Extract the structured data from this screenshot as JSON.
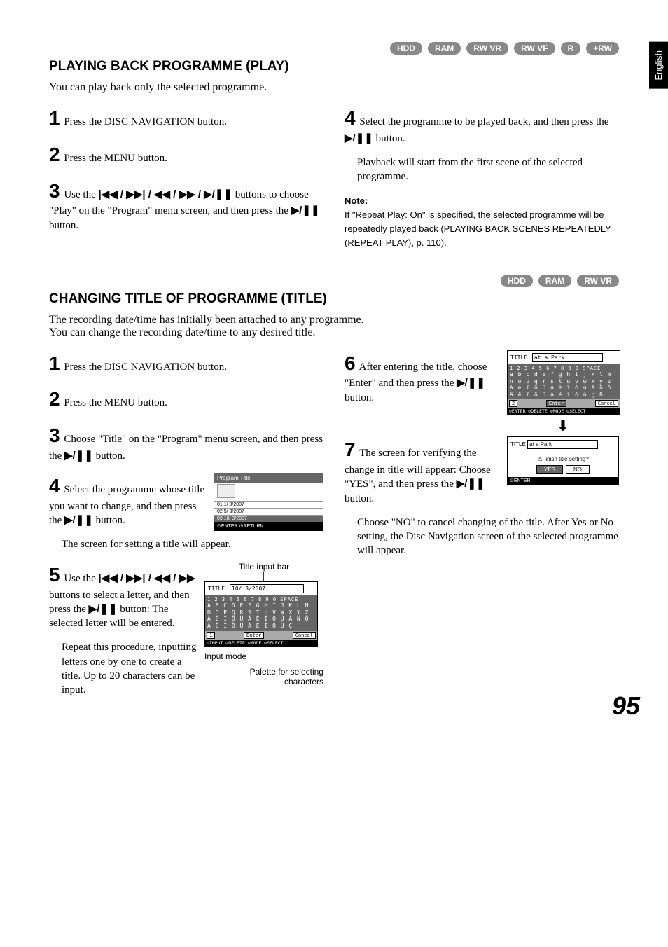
{
  "side_tab": "English",
  "section1": {
    "badges": [
      "HDD",
      "RAM",
      "RW VR",
      "RW VF",
      "R",
      "+RW"
    ],
    "title": "PLAYING BACK PROGRAMME (PLAY)",
    "intro": "You can play back only the selected programme.",
    "steps_left": {
      "s1": "Press the DISC NAVIGATION button.",
      "s2": "Press the MENU button.",
      "s3a": "Use the ",
      "s3b": " buttons to choose \"Play\" on the \"Program\" menu screen, and then press the ",
      "s3c": " button."
    },
    "steps_right": {
      "s4a": "Select the programme to be played back, and then press the ",
      "s4b": " button.",
      "s4c": "Playback will start from the first scene of the selected programme."
    },
    "note_head": "Note:",
    "note_body": "If \"Repeat Play: On\" is specified, the selected programme will be repeatedly played back (PLAYING BACK SCENES REPEATEDLY (REPEAT PLAY), p. 110)."
  },
  "section2": {
    "badges": [
      "HDD",
      "RAM",
      "RW VR"
    ],
    "title": "CHANGING TITLE OF PROGRAMME (TITLE)",
    "intro": "The recording date/time has initially been attached to any programme.\nYou can change the recording date/time to any desired title.",
    "left": {
      "s1": "Press the DISC NAVIGATION button.",
      "s2": "Press the MENU button.",
      "s3a": "Choose \"Title\" on the \"Program\" menu screen, and then press the ",
      "s3b": " button.",
      "s4a": "Select the programme whose title you want to change, and then press the ",
      "s4b": " button.",
      "s4c": "The screen for setting a title will appear.",
      "s5a": "Use the ",
      "s5b": " buttons to select a letter, and then press the ",
      "s5c": " button: The selected letter will be entered.",
      "s5d": "Repeat this procedure, inputting letters one by one to create a title. Up to 20 characters can be input."
    },
    "right": {
      "s6a": "After entering the title, choose \"Enter\" and then press the ",
      "s6b": " button.",
      "s7a": "The screen for verifying the change in title will appear: Choose \"YES\", and then press the ",
      "s7b": " button.",
      "after": "Choose \"NO\" to cancel changing of the title. After Yes or No setting, the Disc Navigation screen of the selected programme will appear."
    },
    "program_title_screen": {
      "header": "Program Title",
      "r1": "01   1/  3/2007",
      "r2": "02   5/  3/2007",
      "r3": "03  10/  3/2007",
      "footer": "⊙ENTER  ⊙RETURN"
    },
    "title_input": {
      "label_bar": "Title input bar",
      "label_input_mode": "Input mode",
      "label_palette": "Palette for selecting\ncharacters",
      "title_label": "TITLE",
      "bar_value": "10/ 3/2007",
      "row1": "1 2 3 4 5 6 7 8 9 0 SPACE",
      "row2": "A B C D E F G H I J K L M",
      "row3": "N O P Q R S T U V W X Y Z",
      "row4": "À É Î Õ Ü Á È Ï Ò Ú Â Ñ Ǒ",
      "row5": "Ä Ë Î Ö Ü À É Í Ó Ù Ç",
      "mode": "1",
      "enter": "Enter",
      "cancel": "Cancel",
      "footer": "⊙INPUT ⊙DELETE ⊙MODE ⊙SELECT"
    },
    "title_confirm_small": {
      "title_label": "TITLE",
      "bar_value": "at a Park",
      "row1": "1 2 3 4 5 6 7 8 9 0 SPACE",
      "row2": "a b c d e f g h i j k l m",
      "row3": "n o p q r s t u v w x y z",
      "row4": "à é î õ ü á è ï ò ú â ñ ǒ",
      "row5": "ä ë î ö ü à é í ó ù ç ß",
      "mode": "2",
      "enter": "Enter",
      "cancel": "Cancel",
      "footer": "⊙ENTER ⊙DELETE ⊙MODE ⊙SELECT"
    },
    "confirm_screen": {
      "title_label": "TITLE",
      "bar_value": "at a Park",
      "msg": "⚠Finish title setting?",
      "yes": "YES",
      "no": "NO",
      "footer": "⊙ENTER"
    }
  },
  "icons": {
    "nav_all": "|◀◀ / ▶▶| / ◀◀ / ▶▶ / ▶/❚❚",
    "nav_four": "|◀◀ / ▶▶| / ◀◀ / ▶▶",
    "play_pause": "▶/❚❚"
  },
  "page_number": "95"
}
